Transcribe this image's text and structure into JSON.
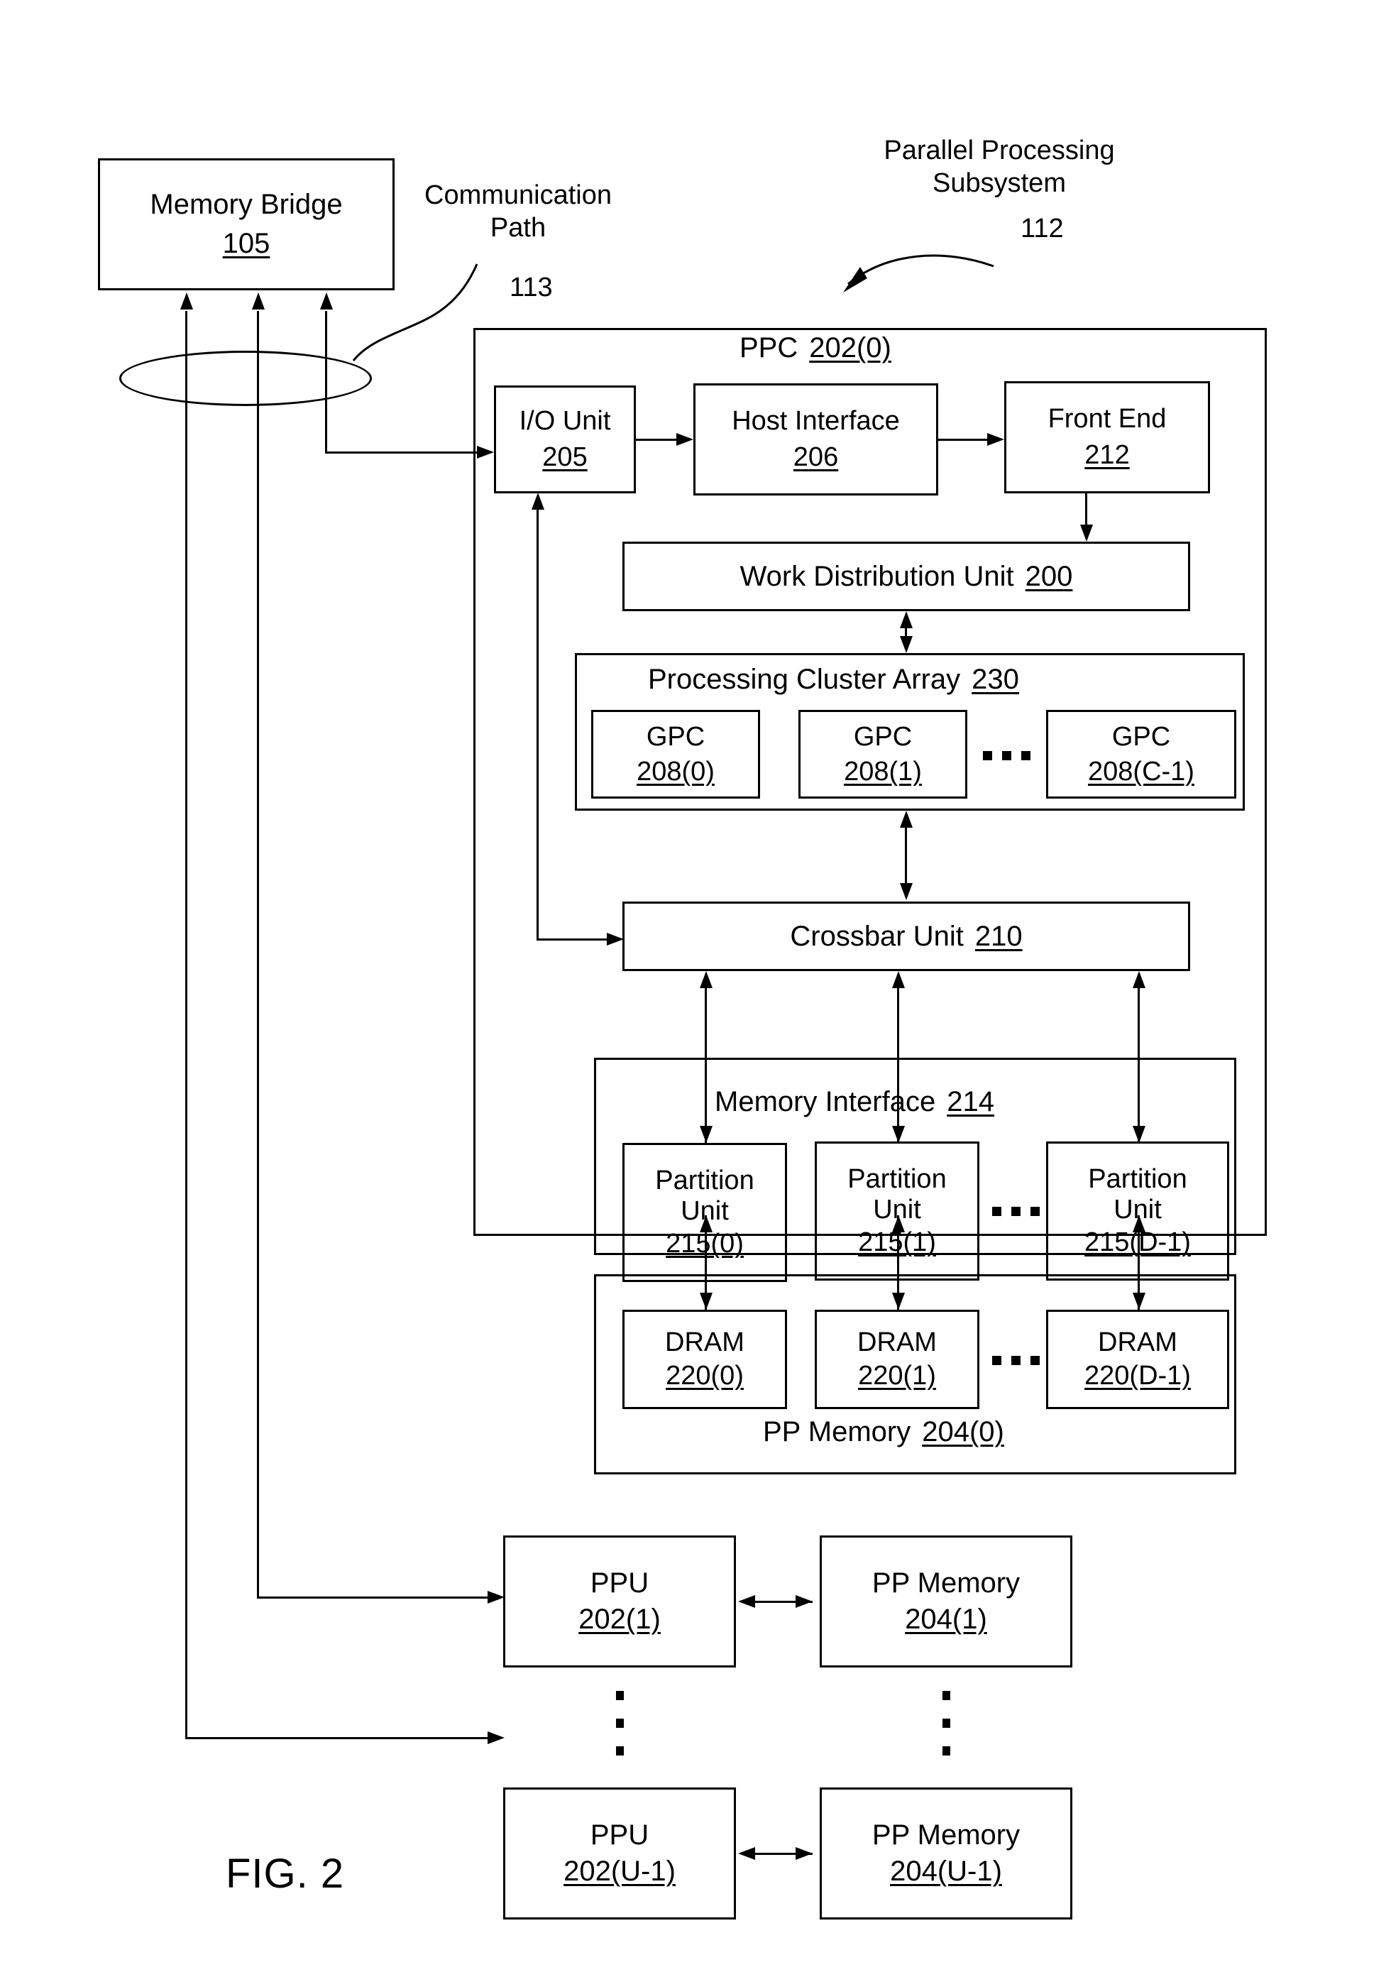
{
  "figure": {
    "caption": "FIG. 2"
  },
  "annotations": {
    "communication_path_line1": "Communication",
    "communication_path_line2": "Path",
    "communication_path_number": "113",
    "subsystem_line1": "Parallel Processing",
    "subsystem_line2": "Subsystem",
    "subsystem_number": "112"
  },
  "memory_bridge": {
    "label": "Memory Bridge",
    "number": "105"
  },
  "ppu": {
    "label": "PPC",
    "number": "202(0)",
    "io_unit": {
      "label": "I/O Unit",
      "number": "205"
    },
    "host_interface": {
      "label": "Host Interface",
      "number": "206"
    },
    "front_end": {
      "label": "Front End",
      "number": "212"
    },
    "work_distribution_unit": {
      "label": "Work Distribution Unit",
      "number": "200"
    },
    "processing_cluster_array": {
      "label": "Processing Cluster Array",
      "number": "230",
      "gpcs": [
        {
          "label": "GPC",
          "number": "208(0)"
        },
        {
          "label": "GPC",
          "number": "208(1)"
        },
        {
          "label": "GPC",
          "number": "208(C-1)"
        }
      ],
      "ellipsis": "..."
    },
    "crossbar_unit": {
      "label": "Crossbar Unit",
      "number": "210"
    },
    "memory_interface": {
      "label": "Memory Interface",
      "number": "214",
      "partition_units": [
        {
          "line1": "Partition",
          "line2": "Unit",
          "number": "215(0)"
        },
        {
          "line1": "Partition",
          "line2": "Unit",
          "number": "215(1)"
        },
        {
          "line1": "Partition",
          "line2": "Unit",
          "number": "215(D-1)"
        }
      ],
      "ellipsis": "..."
    }
  },
  "pp_memory_0": {
    "label": "PP Memory",
    "number": "204(0)",
    "drams": [
      {
        "label": "DRAM",
        "number": "220(0)"
      },
      {
        "label": "DRAM",
        "number": "220(1)"
      },
      {
        "label": "DRAM",
        "number": "220(D-1)"
      }
    ],
    "ellipsis": "..."
  },
  "additional_ppus": [
    {
      "ppu": {
        "label": "PPU",
        "number": "202(1)"
      },
      "memory": {
        "label": "PP Memory",
        "number": "204(1)"
      }
    },
    {
      "ppu": {
        "label": "PPU",
        "number": "202(U-1)"
      },
      "memory": {
        "label": "PP Memory",
        "number": "204(U-1)"
      }
    }
  ],
  "vertical_ellipsis": "⋮",
  "colors": {
    "ink": "#000000",
    "background": "#ffffff"
  }
}
